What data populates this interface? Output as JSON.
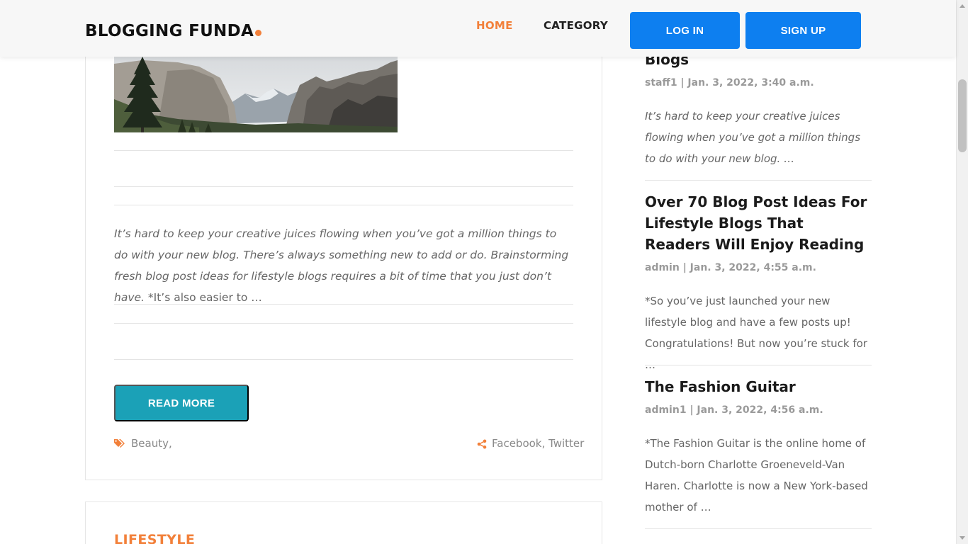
{
  "header": {
    "logo": "BLOGGING FUNDA",
    "nav": {
      "home": "HOME",
      "category": "CATEGORY"
    },
    "login": "LOG IN",
    "signup": "SIGN UP"
  },
  "post": {
    "excerpt_italic": "It’s hard to keep your creative juices flowing when you’ve got a million things to do with your new blog. There’s always something new to add or do. Brainstorming fresh blog post ideas for lifestyle blogs requires a bit of time that you just don’t have.",
    "excerpt_normal": " *It’s also easier to …",
    "read_more": "READ MORE",
    "tags": "Beauty,",
    "share": "Facebook, Twitter"
  },
  "next_post": {
    "category": "LIFESTYLE"
  },
  "sidebar": {
    "items": [
      {
        "title": "Blogs",
        "meta": "staff1 | Jan. 3, 2022, 3:40 a.m.",
        "excerpt": "It’s hard to keep your creative juices flowing when you’ve got a million things to do with your new blog. …"
      },
      {
        "title": "Over 70 Blog Post Ideas For Lifestyle Blogs That Readers Will Enjoy Reading",
        "meta": "admin | Jan. 3, 2022, 4:55 a.m.",
        "excerpt": "*So you’ve just launched your new lifestyle blog and have a few posts up! Congratulations! But now you’re stuck for …"
      },
      {
        "title": "The Fashion Guitar",
        "meta": "admin1 | Jan. 3, 2022, 4:56 a.m.",
        "excerpt": "*The Fashion Guitar is the online home of Dutch-born Charlotte Groeneveld-Van Haren. Charlotte is now a New York-based mother of …"
      }
    ]
  },
  "colors": {
    "accent": "#f2803a",
    "primary_button": "#0d7ff0",
    "read_more_button": "#1ba1b7"
  }
}
